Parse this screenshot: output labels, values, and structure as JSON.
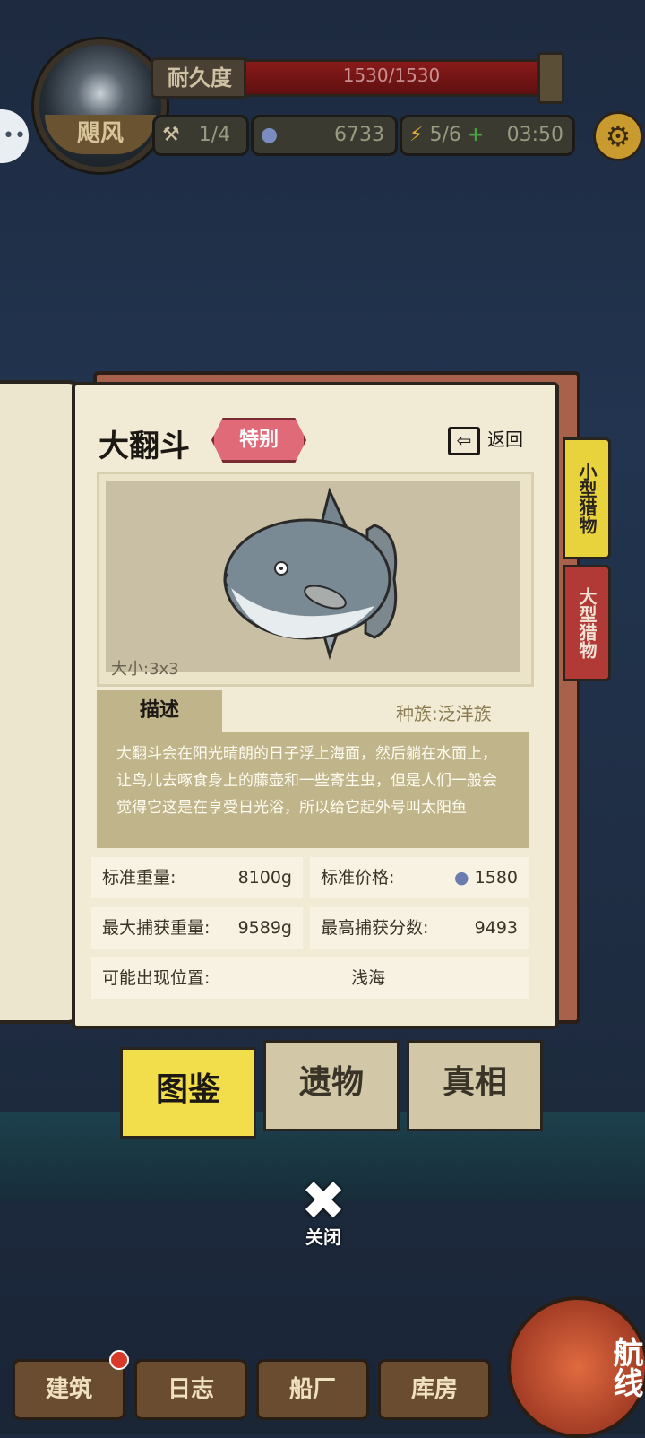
{
  "hud": {
    "storm_label": "飓风",
    "durability_label": "耐久度",
    "durability_value": "1530/1530",
    "durability_fraction": 1.0,
    "tools": "1/4",
    "coins": "6733",
    "energy": "5/6",
    "timer": "03:50"
  },
  "book": {
    "tab_small": "小型猎物",
    "tab_big": "大型猎物",
    "title": "大翻斗",
    "badge": "特别",
    "back_label": "返回",
    "size": "大小:3x3",
    "desc_tab": "描述",
    "race": "种族:泛洋族",
    "description": "大翻斗会在阳光晴朗的日子浮上海面，然后躺在水面上，让鸟儿去啄食身上的藤壶和一些寄生虫，但是人们一般会觉得它这是在享受日光浴，所以给它起外号叫太阳鱼",
    "stats": {
      "std_weight_label": "标准重量:",
      "std_weight": "8100g",
      "std_price_label": "标准价格:",
      "std_price": "1580",
      "max_weight_label": "最大捕获重量:",
      "max_weight": "9589g",
      "max_score_label": "最高捕获分数:",
      "max_score": "9493",
      "location_label": "可能出现位置:",
      "location": "浅海"
    }
  },
  "tabs": [
    "图鉴",
    "遗物",
    "真相"
  ],
  "close_label": "关闭",
  "nav": [
    "建筑",
    "日志",
    "船厂",
    "库房"
  ],
  "route_label": "航线"
}
